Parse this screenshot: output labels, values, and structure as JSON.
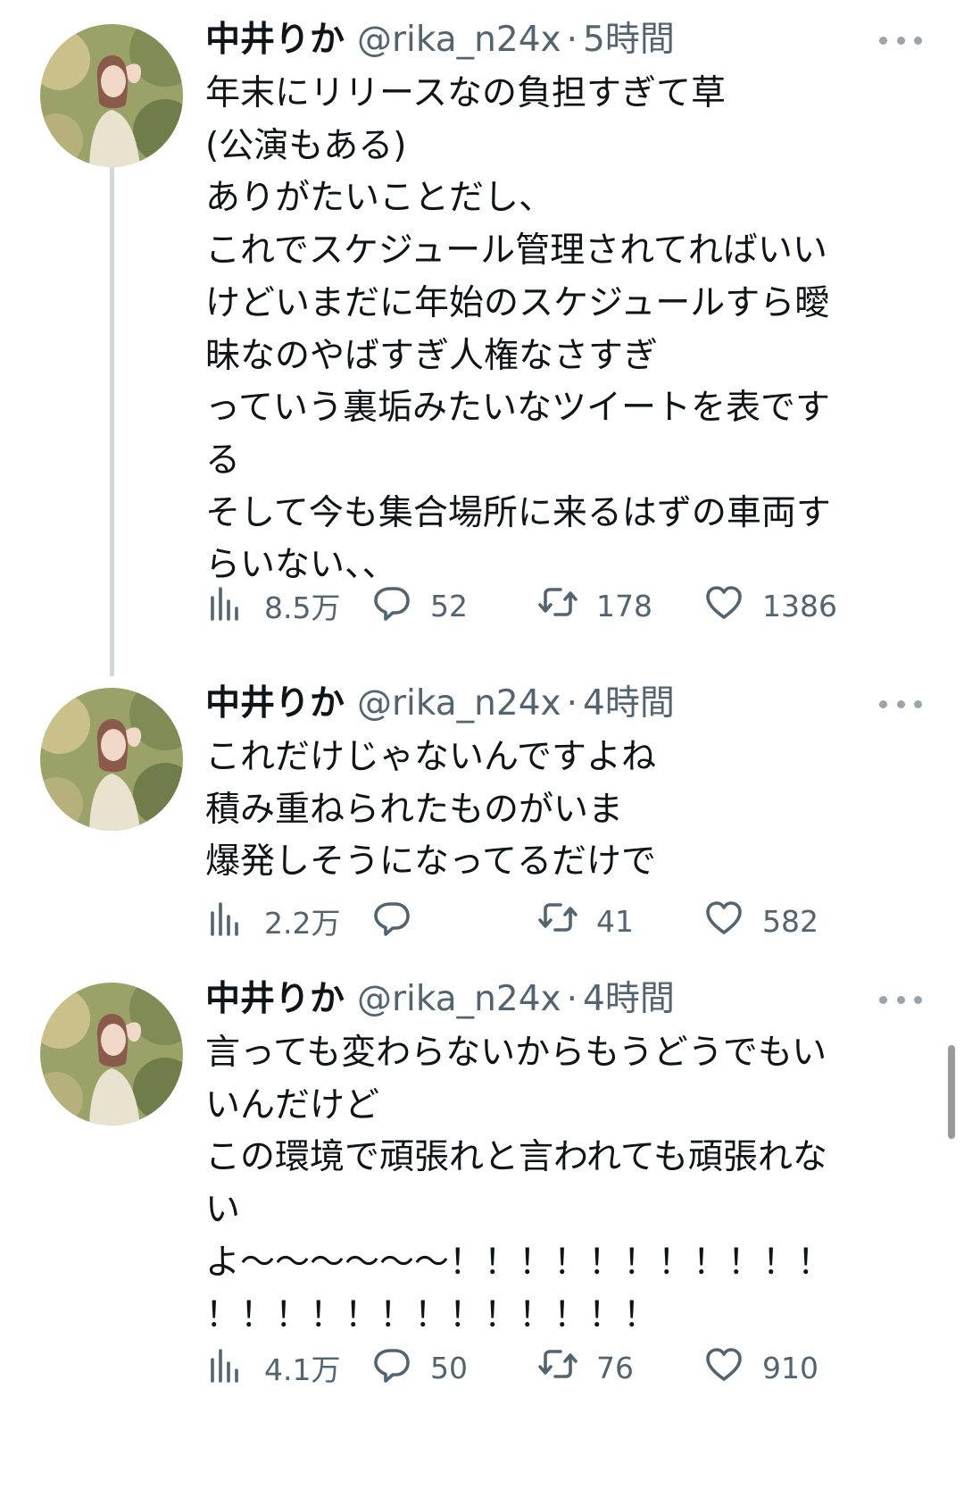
{
  "tweets": [
    {
      "name": "中井りか",
      "handle": "@rika_n24x",
      "separator": "·",
      "time": "5時間",
      "lines": [
        "年末にリリースなの負担すぎて草",
        "(公演もある)",
        "ありがたいことだし、",
        "これでスケジュール管理されてればいい",
        "けどいまだに年始のスケジュールすら曖",
        "昧なのやばすぎ人権なさすぎ",
        "っていう裏垢みたいなツイートを表です",
        "る",
        "そして今も集合場所に来るはずの車両す",
        "らいない、、"
      ],
      "views": "8.5万",
      "replies": "52",
      "retweets": "178",
      "likes": "1386"
    },
    {
      "name": "中井りか",
      "handle": "@rika_n24x",
      "separator": "·",
      "time": "4時間",
      "lines": [
        "これだけじゃないんですよね",
        "積み重ねられたものがいま",
        "爆発しそうになってるだけで"
      ],
      "views": "2.2万",
      "replies": "",
      "retweets": "41",
      "likes": "582"
    },
    {
      "name": "中井りか",
      "handle": "@rika_n24x",
      "separator": "·",
      "time": "4時間",
      "lines": [
        "言っても変わらないからもうどうでもい",
        "いんだけど",
        "この環境で頑張れと言われても頑張れな",
        "い",
        "よ〜〜〜〜〜〜！！！！！！！！！！！",
        "！！！！！！！！！！！！！"
      ],
      "views": "4.1万",
      "replies": "50",
      "retweets": "76",
      "likes": "910"
    }
  ],
  "icons": {
    "views": "bar-chart-icon",
    "reply": "speech-bubble-icon",
    "retweet": "retweet-arrows-icon",
    "like": "heart-icon",
    "more": "more-horizontal-icon"
  },
  "colors": {
    "text": "#0f1419",
    "secondary": "#536471",
    "thread_line": "#cfd9de",
    "background": "#ffffff"
  }
}
